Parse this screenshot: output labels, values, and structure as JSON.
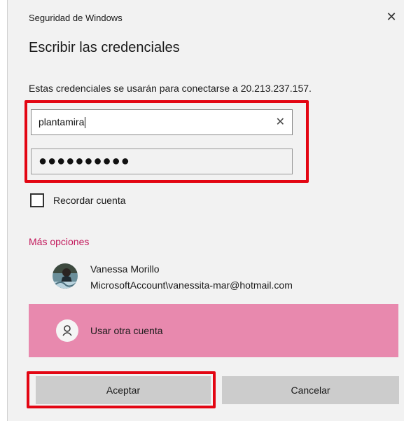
{
  "window": {
    "title": "Seguridad de Windows",
    "close_glyph": "✕"
  },
  "dialog": {
    "heading": "Escribir las credenciales",
    "description": "Estas credenciales se usarán para conectarse a 20.213.237.157."
  },
  "fields": {
    "username_value": "plantamira",
    "password_masked": "●●●●●●●●●●",
    "clear_glyph": "✕"
  },
  "remember": {
    "label": "Recordar cuenta",
    "checked": false
  },
  "more_options": {
    "label": "Más opciones"
  },
  "account": {
    "name": "Vanessa Morillo",
    "email": "MicrosoftAccount\\vanessita-mar@hotmail.com"
  },
  "other_account": {
    "label": "Usar otra cuenta"
  },
  "buttons": {
    "ok": "Aceptar",
    "cancel": "Cancelar"
  },
  "colors": {
    "highlight_red": "#e30613",
    "more_options_text": "#c2185b",
    "other_account_bg": "#e889ae",
    "dialog_bg": "#f2f2f2"
  },
  "icons": {
    "close": "close-icon",
    "clear": "clear-icon",
    "avatar": "avatar-photo",
    "person": "person-icon"
  }
}
